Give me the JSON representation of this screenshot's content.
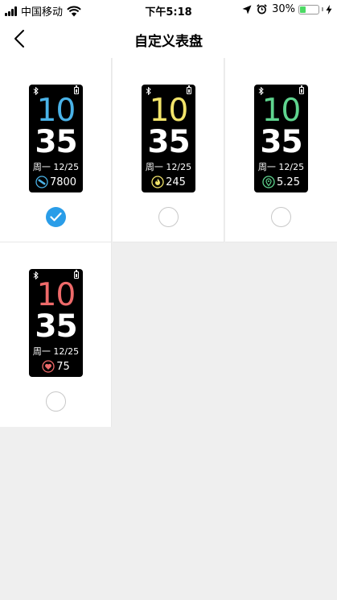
{
  "status_bar": {
    "carrier": "中国移动",
    "time": "下午5:18",
    "battery_percent": "30%",
    "battery_level": 0.3,
    "battery_color": "#4cd964"
  },
  "nav": {
    "title": "自定义表盘",
    "back_icon": "chevron-left-icon"
  },
  "accent_color": "#2a9de8",
  "watch_faces": [
    {
      "hour": "10",
      "minute": "35",
      "date": "周一 12/25",
      "stat_value": "7800",
      "stat_icon": "steps-icon",
      "hour_color": "#4ab3e8",
      "icon_color": "#4ab3e8",
      "selected": true
    },
    {
      "hour": "10",
      "minute": "35",
      "date": "周一 12/25",
      "stat_value": "245",
      "stat_icon": "flame-icon",
      "hour_color": "#f2e46a",
      "icon_color": "#f2e46a",
      "selected": false
    },
    {
      "hour": "10",
      "minute": "35",
      "date": "周一 12/25",
      "stat_value": "5.25",
      "stat_icon": "location-pin-icon",
      "hour_color": "#5fd58f",
      "icon_color": "#5fd58f",
      "selected": false
    },
    {
      "hour": "10",
      "minute": "35",
      "date": "周一 12/25",
      "stat_value": "75",
      "stat_icon": "heart-icon",
      "hour_color": "#ee6a6a",
      "icon_color": "#ee6a6a",
      "selected": false
    }
  ]
}
